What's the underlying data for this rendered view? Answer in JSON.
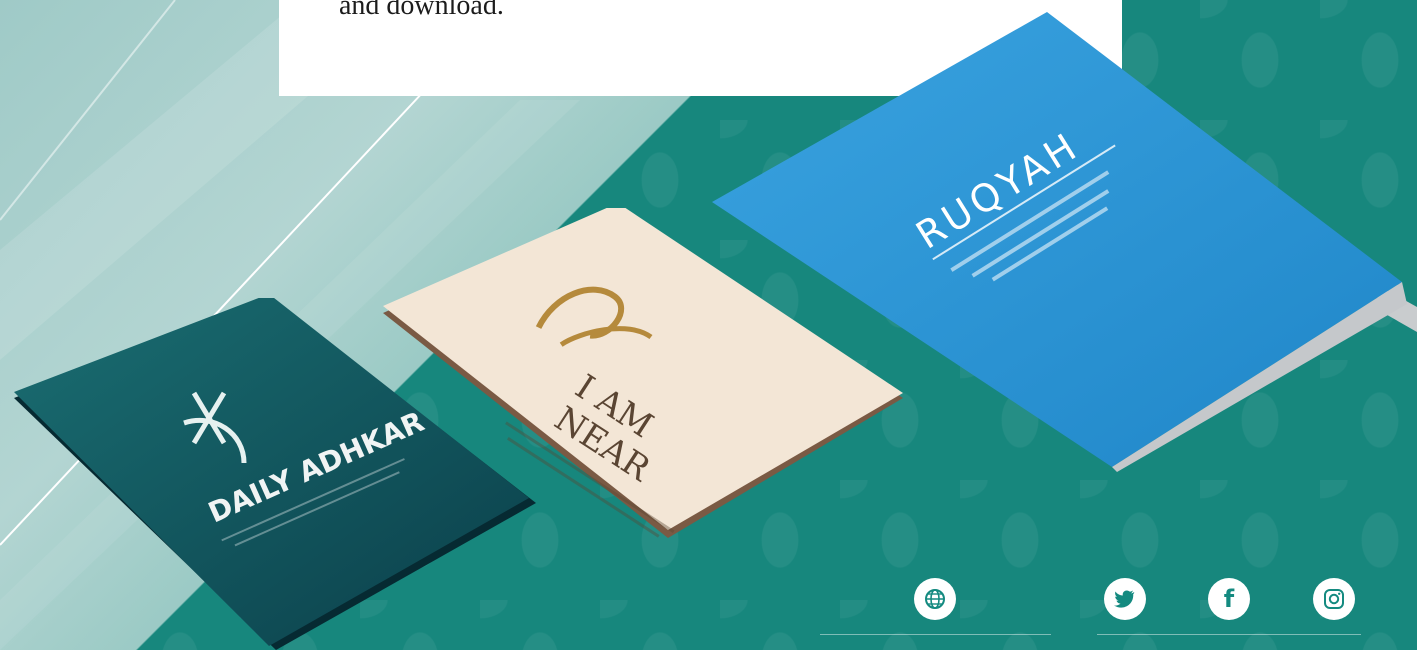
{
  "card": {
    "text": "and download."
  },
  "books": [
    {
      "title": "DAILY ADHKAR"
    },
    {
      "title_line1": "I AM",
      "title_line2": "NEAR"
    },
    {
      "title": "RUQYAH"
    }
  ],
  "footer": {
    "website_icon": "globe-icon",
    "social_icons": [
      "twitter-icon",
      "facebook-icon",
      "instagram-icon"
    ],
    "website_text": "",
    "social_text": ""
  },
  "colors": {
    "teal": "#17877d",
    "ruqyah_blue": "#2f97d6",
    "cream": "#f3e6d6"
  }
}
